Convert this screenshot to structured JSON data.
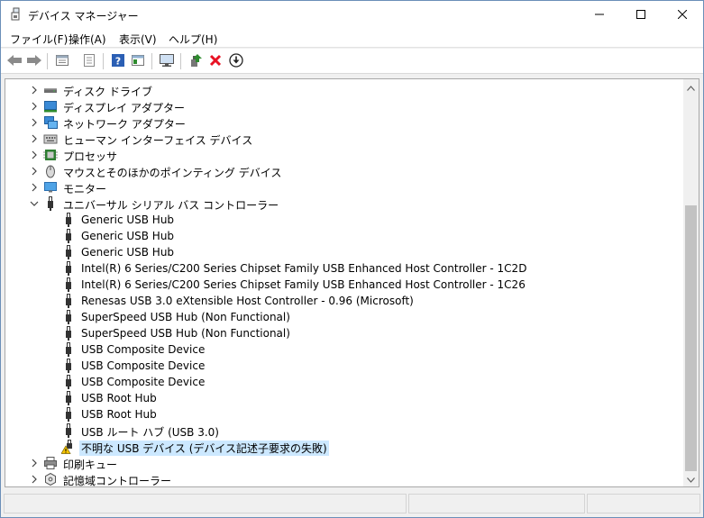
{
  "window": {
    "title": "デバイス マネージャー",
    "controls": {
      "minimize": "minimize",
      "maximize": "maximize",
      "close": "close"
    }
  },
  "menu": [
    {
      "label": "ファイル(F)"
    },
    {
      "label": "操作(A)"
    },
    {
      "label": "表示(V)"
    },
    {
      "label": "ヘルプ(H)"
    }
  ],
  "toolbar": {
    "icons": [
      "back-arrow-icon",
      "forward-arrow-icon",
      "properties-list-icon",
      "show-hidden-icon",
      "help-icon",
      "view-pane-icon",
      "monitor-scan-icon",
      "update-driver-icon",
      "uninstall-icon",
      "download-icon"
    ],
    "colors": {
      "uninstall": "#e81123",
      "update": "#2e8b2e",
      "help": "#2b5fb4"
    }
  },
  "tree": {
    "items": [
      {
        "label": "ディスク ドライブ",
        "icon": "disk-drive-icon",
        "level": 0,
        "expander": "collapsed"
      },
      {
        "label": "ディスプレイ アダプター",
        "icon": "display-adapter-icon",
        "level": 0,
        "expander": "collapsed"
      },
      {
        "label": "ネットワーク アダプター",
        "icon": "network-adapter-icon",
        "level": 0,
        "expander": "collapsed"
      },
      {
        "label": "ヒューマン インターフェイス デバイス",
        "icon": "hid-icon",
        "level": 0,
        "expander": "collapsed"
      },
      {
        "label": "プロセッサ",
        "icon": "processor-icon",
        "level": 0,
        "expander": "collapsed"
      },
      {
        "label": "マウスとそのほかのポインティング デバイス",
        "icon": "mouse-icon",
        "level": 0,
        "expander": "collapsed"
      },
      {
        "label": "モニター",
        "icon": "monitor-icon",
        "level": 0,
        "expander": "collapsed"
      },
      {
        "label": "ユニバーサル シリアル バス コントローラー",
        "icon": "usb-icon",
        "level": 0,
        "expander": "expanded"
      },
      {
        "label": "Generic USB Hub",
        "icon": "usb-icon",
        "level": 1
      },
      {
        "label": "Generic USB Hub",
        "icon": "usb-icon",
        "level": 1
      },
      {
        "label": "Generic USB Hub",
        "icon": "usb-icon",
        "level": 1
      },
      {
        "label": "Intel(R) 6 Series/C200 Series Chipset Family USB Enhanced Host Controller - 1C2D",
        "icon": "usb-icon",
        "level": 1
      },
      {
        "label": "Intel(R) 6 Series/C200 Series Chipset Family USB Enhanced Host Controller - 1C26",
        "icon": "usb-icon",
        "level": 1
      },
      {
        "label": "Renesas USB 3.0 eXtensible Host Controller - 0.96 (Microsoft)",
        "icon": "usb-icon",
        "level": 1
      },
      {
        "label": "SuperSpeed USB Hub (Non Functional)",
        "icon": "usb-icon",
        "level": 1
      },
      {
        "label": "SuperSpeed USB Hub (Non Functional)",
        "icon": "usb-icon",
        "level": 1
      },
      {
        "label": "USB Composite Device",
        "icon": "usb-icon",
        "level": 1
      },
      {
        "label": "USB Composite Device",
        "icon": "usb-icon",
        "level": 1
      },
      {
        "label": "USB Composite Device",
        "icon": "usb-icon",
        "level": 1
      },
      {
        "label": "USB Root Hub",
        "icon": "usb-icon",
        "level": 1
      },
      {
        "label": "USB Root Hub",
        "icon": "usb-icon",
        "level": 1
      },
      {
        "label": "USB ルート ハブ (USB 3.0)",
        "icon": "usb-icon",
        "level": 1
      },
      {
        "label": "不明な USB デバイス (デバイス記述子要求の失敗)",
        "icon": "usb-warning-icon",
        "level": 1,
        "selected": true
      },
      {
        "label": "印刷キュー",
        "icon": "printer-icon",
        "level": 0,
        "expander": "collapsed"
      },
      {
        "label": "記憶域コントローラー",
        "icon": "storage-controller-icon",
        "level": 0,
        "expander": "collapsed"
      }
    ]
  },
  "colors": {
    "selection": "#cce8ff",
    "warning": "#f5c400"
  }
}
